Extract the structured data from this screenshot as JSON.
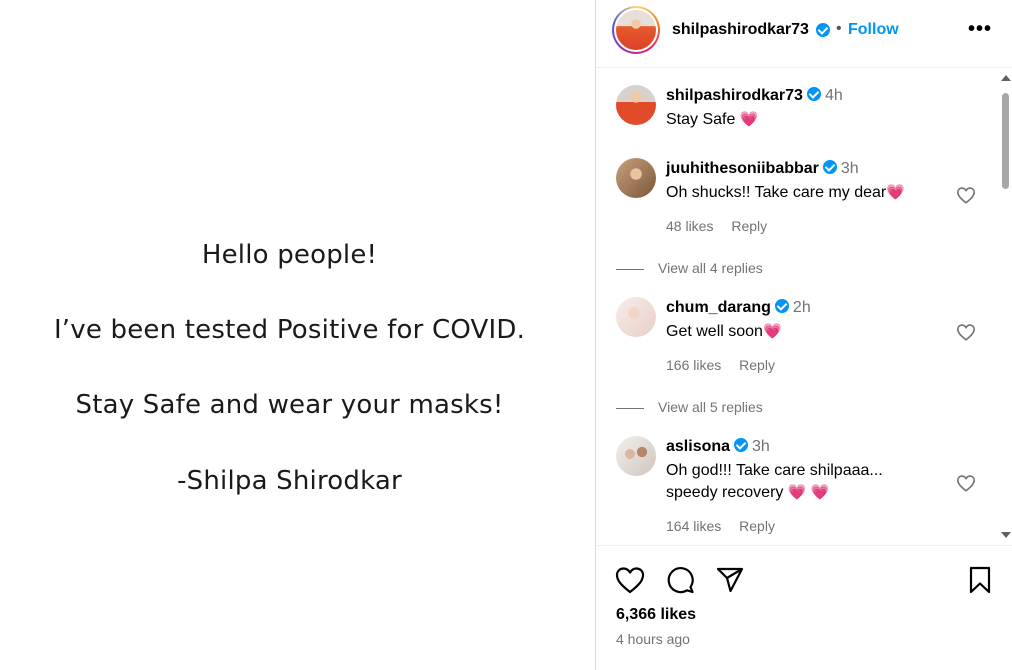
{
  "media": {
    "line1": "Hello people!",
    "line2": "I’ve been tested Positive for COVID.",
    "line3": "Stay Safe and wear your masks!",
    "line4": "-Shilpa Shirodkar"
  },
  "header": {
    "username": "shilpashirodkar73",
    "separator": "•",
    "follow_label": "Follow",
    "more_label": "•••"
  },
  "caption": {
    "username": "shilpashirodkar73",
    "time": "4h",
    "text": "Stay Safe",
    "emoji": "💗"
  },
  "comments": [
    {
      "username": "juuhithesoniibabbar",
      "time": "3h",
      "text": "Oh shucks!! Take care my dear",
      "emoji": "💗",
      "likes": "48 likes",
      "reply_label": "Reply",
      "view_replies": "View all 4 replies"
    },
    {
      "username": "chum_darang",
      "time": "2h",
      "text": "Get well soon",
      "emoji": "💗",
      "likes": "166 likes",
      "reply_label": "Reply",
      "view_replies": "View all 5 replies"
    },
    {
      "username": "aslisona",
      "time": "3h",
      "text_line1": "Oh god!!! Take care shilpaaa...",
      "text_line2": "speedy recovery",
      "emoji": "💗 💗",
      "likes": "164 likes",
      "reply_label": "Reply"
    }
  ],
  "post": {
    "likes": "6,366 likes",
    "time_ago": "4 hours ago"
  },
  "colors": {
    "accent": "#0095f6",
    "secondary_text": "#737373",
    "heart": "#ef2b6d"
  },
  "icons": {
    "like": "heart-outline-icon",
    "comment": "speech-bubble-icon",
    "share": "paper-plane-icon",
    "save": "bookmark-icon",
    "verified": "verified-badge-icon",
    "more": "more-options-icon"
  }
}
